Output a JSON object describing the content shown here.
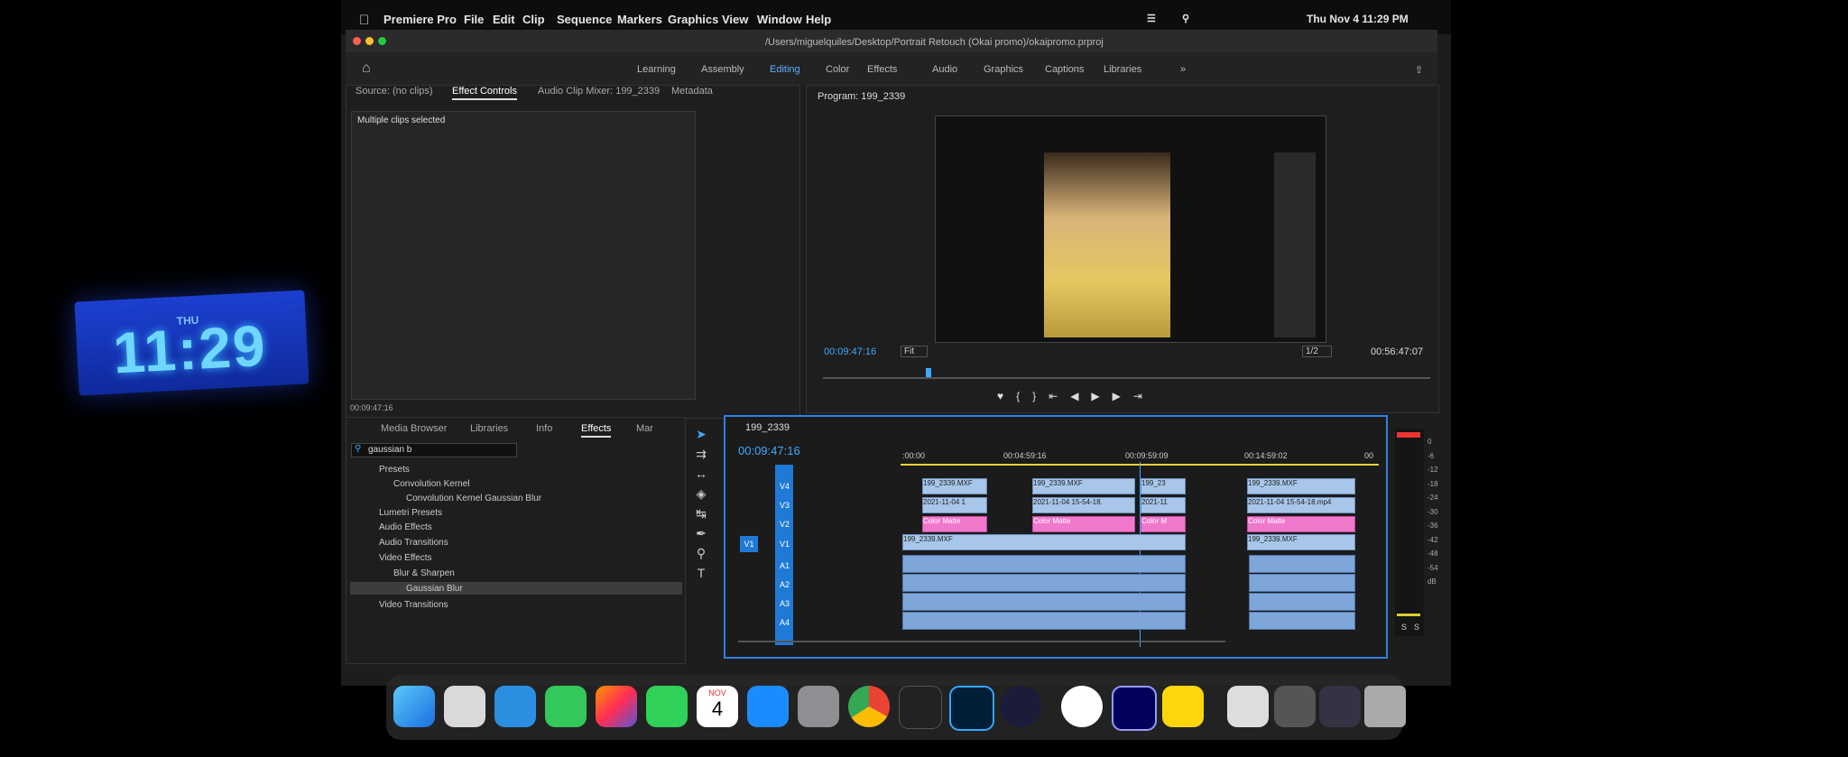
{
  "desk_clock": {
    "day": "THU",
    "time": "11:29"
  },
  "menubar": {
    "app_name": "Premiere Pro",
    "items": [
      "File",
      "Edit",
      "Clip",
      "Sequence",
      "Markers",
      "Graphics",
      "View",
      "Window",
      "Help"
    ],
    "datetime": "Thu Nov 4  11:29 PM"
  },
  "window": {
    "path": "/Users/miguelquiles/Desktop/Portrait Retouch (Okai promo)/okaipromo.prproj"
  },
  "workspaces": {
    "items": [
      "Learning",
      "Assembly",
      "Editing",
      "Color",
      "Effects",
      "Audio",
      "Graphics",
      "Captions",
      "Libraries"
    ],
    "active": "Editing"
  },
  "source_panel": {
    "tabs": [
      "Source: (no clips)",
      "Effect Controls",
      "Audio Clip Mixer: 199_2339",
      "Metadata"
    ],
    "message": "Multiple clips selected",
    "timecode": "00:09:47:16"
  },
  "program_monitor": {
    "title": "Program: 199_2339",
    "timecode": "00:09:47:16",
    "fit": "Fit",
    "resolution": "1/2",
    "duration": "00:56:47:07"
  },
  "effects_panel": {
    "tabs": [
      "Media Browser",
      "Libraries",
      "Info",
      "Effects",
      "Mar"
    ],
    "search_value": "gaussian b",
    "tree": [
      {
        "label": "Presets",
        "indent": 0
      },
      {
        "label": "Convolution Kernel",
        "indent": 1
      },
      {
        "label": "Convolution Kernel Gaussian Blur",
        "indent": 2
      },
      {
        "label": "Lumetri Presets",
        "indent": 0
      },
      {
        "label": "Audio Effects",
        "indent": 0
      },
      {
        "label": "Audio Transitions",
        "indent": 0
      },
      {
        "label": "Video Effects",
        "indent": 0
      },
      {
        "label": "Blur & Sharpen",
        "indent": 1
      },
      {
        "label": "Gaussian Blur",
        "indent": 2
      },
      {
        "label": "Video Transitions",
        "indent": 0
      }
    ]
  },
  "timeline": {
    "sequence": "199_2339",
    "timecode": "00:09:47:16",
    "ruler": [
      ":00:00",
      "00:04:59:16",
      "00:09:59:09",
      "00:14:59:02",
      "00"
    ],
    "tracks": [
      "V4",
      "V3",
      "V2",
      "V1",
      "A1",
      "A2",
      "A3",
      "A4"
    ],
    "clip_labels": {
      "mxf": "199_2339.MXF",
      "mxf_short": "199_23",
      "mp4_a": "2021-11-04 1",
      "mp4_b": "2021-11-04 15-54-18.",
      "mp4_c": "2021-11",
      "mp4_full": "2021-11-04 15-54-18.mp4",
      "matte": "Color Matte",
      "matte_short": "Color M"
    }
  },
  "meter": {
    "scale": [
      "0",
      "-6",
      "-12",
      "-18",
      "-24",
      "-30",
      "-36",
      "-42",
      "-48",
      "-54",
      "dB"
    ],
    "solo": "S"
  },
  "dock": {
    "calendar_month": "NOV",
    "calendar_day": "4"
  }
}
